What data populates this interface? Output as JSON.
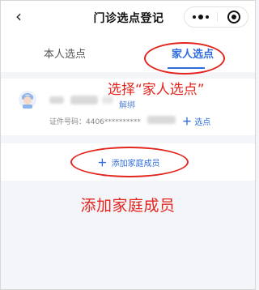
{
  "nav": {
    "back_icon": "‹",
    "title": "门诊选点登记",
    "more_icon": "more-dots-icon",
    "close_icon": "target-close-icon"
  },
  "tabs": [
    {
      "label": "本人选点",
      "active": false
    },
    {
      "label": "家人选点",
      "active": true
    }
  ],
  "member": {
    "unbind_label": "解绑",
    "id_label": "证件号码：4406**********",
    "select_label": "选点"
  },
  "add_member": {
    "label": "添加家庭成员"
  },
  "annotations": {
    "select_family": "选择“家人选点”",
    "add_family": "添加家庭成员"
  },
  "colors": {
    "accent": "#2f6bdd",
    "annotation": "#e2251e",
    "background": "#f3f5f9"
  }
}
